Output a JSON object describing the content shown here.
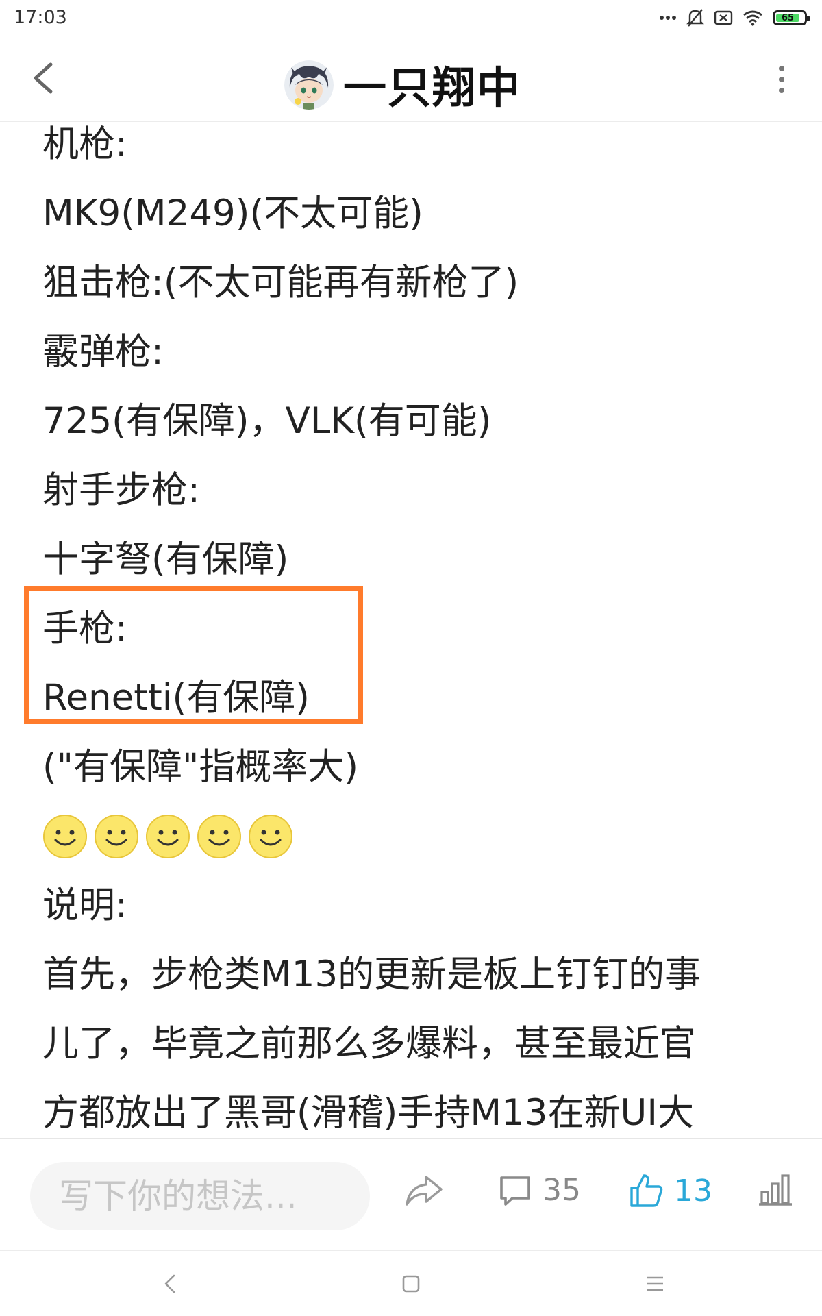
{
  "status_bar": {
    "time": "17:03",
    "battery": "65",
    "icons": [
      "more-dots-icon",
      "bell-muted-icon",
      "sim-off-icon",
      "wifi-icon",
      "battery-icon"
    ]
  },
  "header": {
    "title": "一只翔中",
    "back_icon": "chevron-left-icon",
    "more_icon": "vertical-dots-icon"
  },
  "content": {
    "lines": [
      "机枪:",
      "MK9(M249)(不太可能)",
      "狙击枪:(不太可能再有新枪了)",
      "霰弹枪:",
      "725(有保障)，VLK(有可能)",
      "射手步枪:",
      "十字弩(有保障)",
      "手枪:",
      "Renetti(有保障)",
      "(\"有保障\"指概率大)"
    ],
    "lines_after": [
      "说明:",
      "首先，步枪类M13的更新是板上钉钉的事",
      "儿了，毕竟之前那么多爆料，甚至最近官",
      "方都放出了黑哥(滑稽)手持M13在新UI大"
    ],
    "emoji_count": 5,
    "highlight_color": "#ff7b2c"
  },
  "action_bar": {
    "input_placeholder": "写下你的想法...",
    "comment_count": "35",
    "like_count": "13",
    "like_color": "#2aa8d8",
    "icons": [
      "share-icon",
      "comment-icon",
      "thumbs-up-icon",
      "stats-icon"
    ]
  },
  "nav_bar": {
    "icons": [
      "nav-back-icon",
      "nav-home-icon",
      "nav-menu-icon"
    ]
  }
}
